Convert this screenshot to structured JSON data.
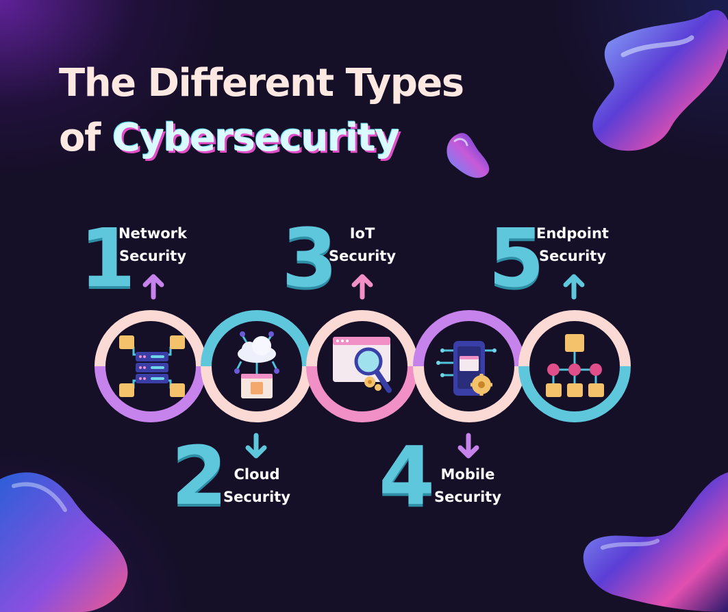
{
  "title": {
    "line1": "The Different Types",
    "prefix": "of ",
    "accent": "Cybersecurity"
  },
  "colors": {
    "background": "#160f28",
    "teal": "#5fc7dc",
    "pink": "#fbd2d2",
    "purple": "#c683ec",
    "magenta": "#f190c6",
    "text": "#ffffff"
  },
  "steps": [
    {
      "number": "1",
      "line1": "Network",
      "line2": "Security",
      "icon": "server-network-icon"
    },
    {
      "number": "2",
      "line1": "Cloud",
      "line2": "Security",
      "icon": "cloud-security-icon"
    },
    {
      "number": "3",
      "line1": "IoT",
      "line2": "Security",
      "icon": "magnifier-window-icon"
    },
    {
      "number": "4",
      "line1": "Mobile",
      "line2": "Security",
      "icon": "mobile-gear-icon"
    },
    {
      "number": "5",
      "line1": "Endpoint",
      "line2": "Security",
      "icon": "hierarchy-icon"
    }
  ]
}
